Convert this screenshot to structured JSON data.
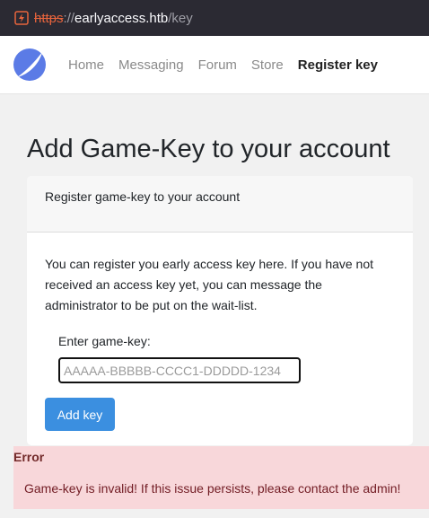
{
  "browser": {
    "url_protocol": "https",
    "url_separator": "://",
    "url_host": "earlyaccess.htb",
    "url_path": "/key"
  },
  "nav": {
    "items": [
      {
        "label": "Home"
      },
      {
        "label": "Messaging"
      },
      {
        "label": "Forum"
      },
      {
        "label": "Store"
      },
      {
        "label": "Register key",
        "active": true
      }
    ]
  },
  "page": {
    "title": "Add Game-Key to your account"
  },
  "card": {
    "header": "Register game-key to your account",
    "text": "You can register you early access key here. If you have not received an access key yet, you can message the administrator to be put on the wait-list.",
    "field_label": "Enter game-key:",
    "field_placeholder": "AAAAA-BBBBB-CCCC1-DDDDD-1234",
    "field_value": "",
    "button_label": "Add key"
  },
  "error": {
    "title": "Error",
    "message": "Game-key is invalid! If this issue persists, please contact the admin!"
  },
  "colors": {
    "accent": "#3b8fe0",
    "error_bg": "#f8d7da",
    "error_text": "#721c24",
    "insecure_protocol": "#e8643c"
  }
}
